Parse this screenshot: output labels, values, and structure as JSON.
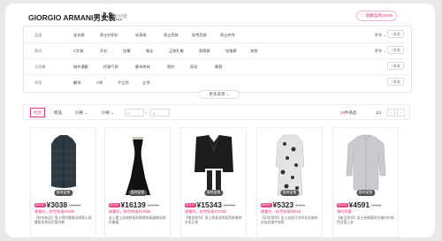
{
  "header": {
    "brand": "GIORGIO ARMANI男女装...",
    "followers": "2.9",
    "followers_unit": "粉丝数",
    "follow_button": "收藏品牌(4530)"
  },
  "filters": [
    {
      "label": "品类",
      "options": [
        "连衣裙",
        "男士针织衫",
        "半身裙",
        "男士西装",
        "女性西装",
        "男士夹克"
      ],
      "more": "更多",
      "multi": "多选"
    },
    {
      "label": "款式",
      "options": [
        "A字裙",
        "开衫",
        "连帽",
        "格达",
        "正装礼服",
        "直筒裤",
        "铅笔裤",
        "其他"
      ],
      "more": "更多",
      "multi": "多选"
    },
    {
      "label": "主风格",
      "options": [
        "城乡通勤",
        "优雅气质",
        "都市休闲",
        "简约",
        "英伦",
        "摩登"
      ],
      "more": "",
      "multi": "多选"
    },
    {
      "label": "领型",
      "options": [
        "翻领",
        "V领",
        "平立领",
        "立领"
      ],
      "more": "",
      "multi": "多选"
    }
  ],
  "more_options": "更多选项",
  "sortbar": {
    "sort_default": "综合",
    "sort_new": "新品",
    "sort_price": "价格",
    "price_range_label": "价格",
    "price_min_placeholder": "¥",
    "price_sep": "-",
    "price_max_placeholder": "¥",
    "count": "39",
    "count_unit": "件商品",
    "page": "1/1"
  },
  "products": [
    {
      "tag": "限时促销",
      "badge": "到手价",
      "price": "¥3038",
      "orig": "¥12500",
      "promo": "限量价，抢完恢复¥3380",
      "title": "【秋冬新品】男士简约菱格羽绒背心保暖防风休闲百搭外套"
    },
    {
      "tag": "限时促销",
      "badge": "到手价",
      "price": "¥16139",
      "orig": "¥27000",
      "promo": "限量价，抢完恢复¥17936",
      "title": "女士重工丝绒拼接珍珠装饰高级感长款礼服裙"
    },
    {
      "tag": "限时促销",
      "badge": "到手价",
      "price": "¥15343",
      "orig": "¥27500",
      "promo": "限量价，抢完恢复¥17052",
      "title": "【商务系列】男士修身双排扣西装套装羊毛正装"
    },
    {
      "tag": "限时促销",
      "badge": "到手价",
      "price": "¥5323",
      "orig": "¥9500",
      "promo": "限量价，抢完恢复¥5918",
      "title": "【印花系列】女士丝质几何印花长袖衬衫连衣裙中长款"
    },
    {
      "tag": "限时促销",
      "badge": "到手价",
      "price": "¥4591",
      "orig": "¥7500",
      "promo": "限时优惠",
      "title": "【新品系列】女士经典廓形长袖衬衫纯色百搭上衣"
    }
  ],
  "colors": {
    "accent": "#e4367e"
  }
}
